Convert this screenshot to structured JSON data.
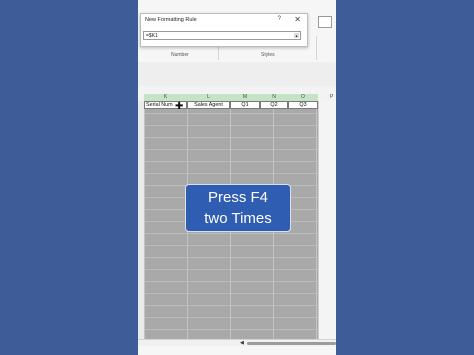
{
  "dialog": {
    "title": "New Formatting Rule",
    "help": "?",
    "close": "✕",
    "formula": "=$K1",
    "collapse_icon": "collapse-icon"
  },
  "ribbon": {
    "groups": [
      "Number",
      "Styles"
    ]
  },
  "sheet": {
    "columns": [
      "K",
      "L",
      "M",
      "N",
      "O",
      "P"
    ],
    "selected_columns": [
      "K",
      "L",
      "M",
      "N",
      "O"
    ],
    "header_cells": [
      "Serial Num",
      "Sales Agent",
      "Q1",
      "Q2",
      "Q3"
    ]
  },
  "overlay": {
    "line1": "Press F4",
    "line2": "two Times"
  },
  "scroll": {
    "left_arrow": "◀"
  },
  "colors": {
    "background": "#3d5c98",
    "overlay": "#2e5db2",
    "selected_header": "#c7e3c7"
  }
}
